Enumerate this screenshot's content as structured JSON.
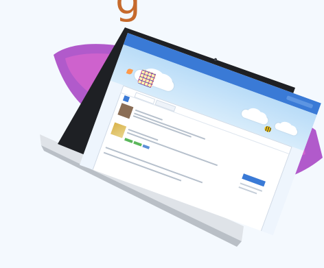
{
  "top_text": "g",
  "colors": {
    "page_bg": "#f4f9fe",
    "brush_dark": "#9b2dbf",
    "brush_light": "#e56ad0",
    "laptop_body": "#e7eaee",
    "screen_bezel": "#1e2024",
    "nav_blue": "#3a7ad6",
    "top_letter": "#c66a2c"
  },
  "icons": {
    "webcam": "webcam-icon",
    "butterfly": "butterfly-icon",
    "bee": "bee-icon",
    "logo": "tictactoe-logo-icon"
  }
}
